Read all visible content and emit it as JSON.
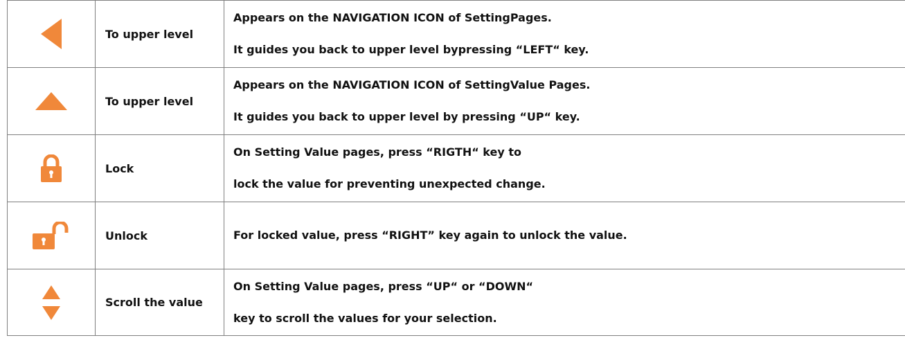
{
  "colors": {
    "icon_orange": "#f0883a",
    "border": "#7f7f7f"
  },
  "rows": [
    {
      "icon": "left-triangle-icon",
      "name": "To upper level",
      "desc": [
        "Appears on the NAVIGATION ICON of SettingPages.",
        "It guides you back to upper level bypressing “LEFT“ key."
      ]
    },
    {
      "icon": "up-triangle-icon",
      "name": "To upper level",
      "desc": [
        "Appears on the NAVIGATION ICON of SettingValue Pages.",
        "It guides you back to upper level by pressing “UP“ key."
      ]
    },
    {
      "icon": "lock-icon",
      "name": "Lock",
      "desc": [
        "On Setting Value pages, press “RIGTH“ key to",
        "lock the value for preventing unexpected change."
      ]
    },
    {
      "icon": "unlock-icon",
      "name": "Unlock",
      "desc": [
        "For locked value, press “RIGHT” key again to unlock the value."
      ]
    },
    {
      "icon": "scroll-arrows-icon",
      "name": "Scroll the value",
      "desc": [
        "On Setting Value pages, press “UP“ or “DOWN“",
        "key to scroll the values for your selection."
      ]
    }
  ]
}
